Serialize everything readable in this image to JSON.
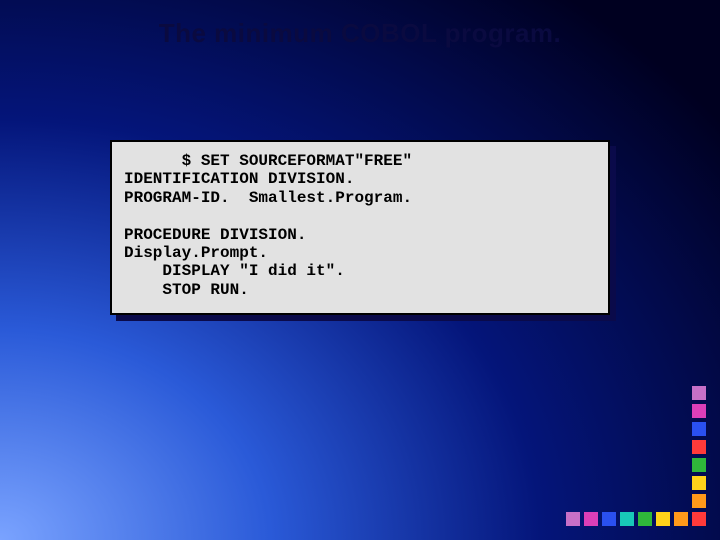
{
  "title": "The minimum COBOL program.",
  "code": "      $ SET SOURCEFORMAT\"FREE\"\nIDENTIFICATION DIVISION.\nPROGRAM-ID.  Smallest.Program.\n\nPROCEDURE DIVISION.\nDisplay.Prompt.\n    DISPLAY \"I did it\".\n    STOP RUN.",
  "square_colors": {
    "vertical": [
      "#c770c7",
      "#db3fb8",
      "#2a50f0",
      "#ff3a3a",
      "#2fb83a",
      "#ffd21a",
      "#ff9a1a"
    ],
    "horizontal": [
      "#ff3a3a",
      "#ff9a1a",
      "#ffd21a",
      "#2fb83a",
      "#18c8b8",
      "#2a50f0",
      "#db3fb8",
      "#c770c7"
    ]
  }
}
